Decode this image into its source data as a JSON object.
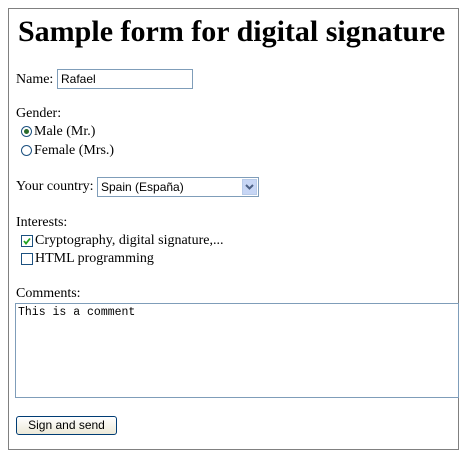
{
  "title": "Sample form for digital signature",
  "name": {
    "label": "Name:",
    "value": "Rafael"
  },
  "gender": {
    "label": "Gender:",
    "options": [
      "Male (Mr.)",
      "Female (Mrs.)"
    ],
    "selected": "Male (Mr.)"
  },
  "country": {
    "label": "Your country:",
    "selected": "Spain (España)",
    "icon": "chevron-down-icon"
  },
  "interests": {
    "label": "Interests:",
    "options": [
      {
        "label": "Cryptography, digital signature,...",
        "checked": true
      },
      {
        "label": "HTML programming",
        "checked": false
      }
    ]
  },
  "comments": {
    "label": "Comments:",
    "value": "This is a comment"
  },
  "submit_label": "Sign and send"
}
